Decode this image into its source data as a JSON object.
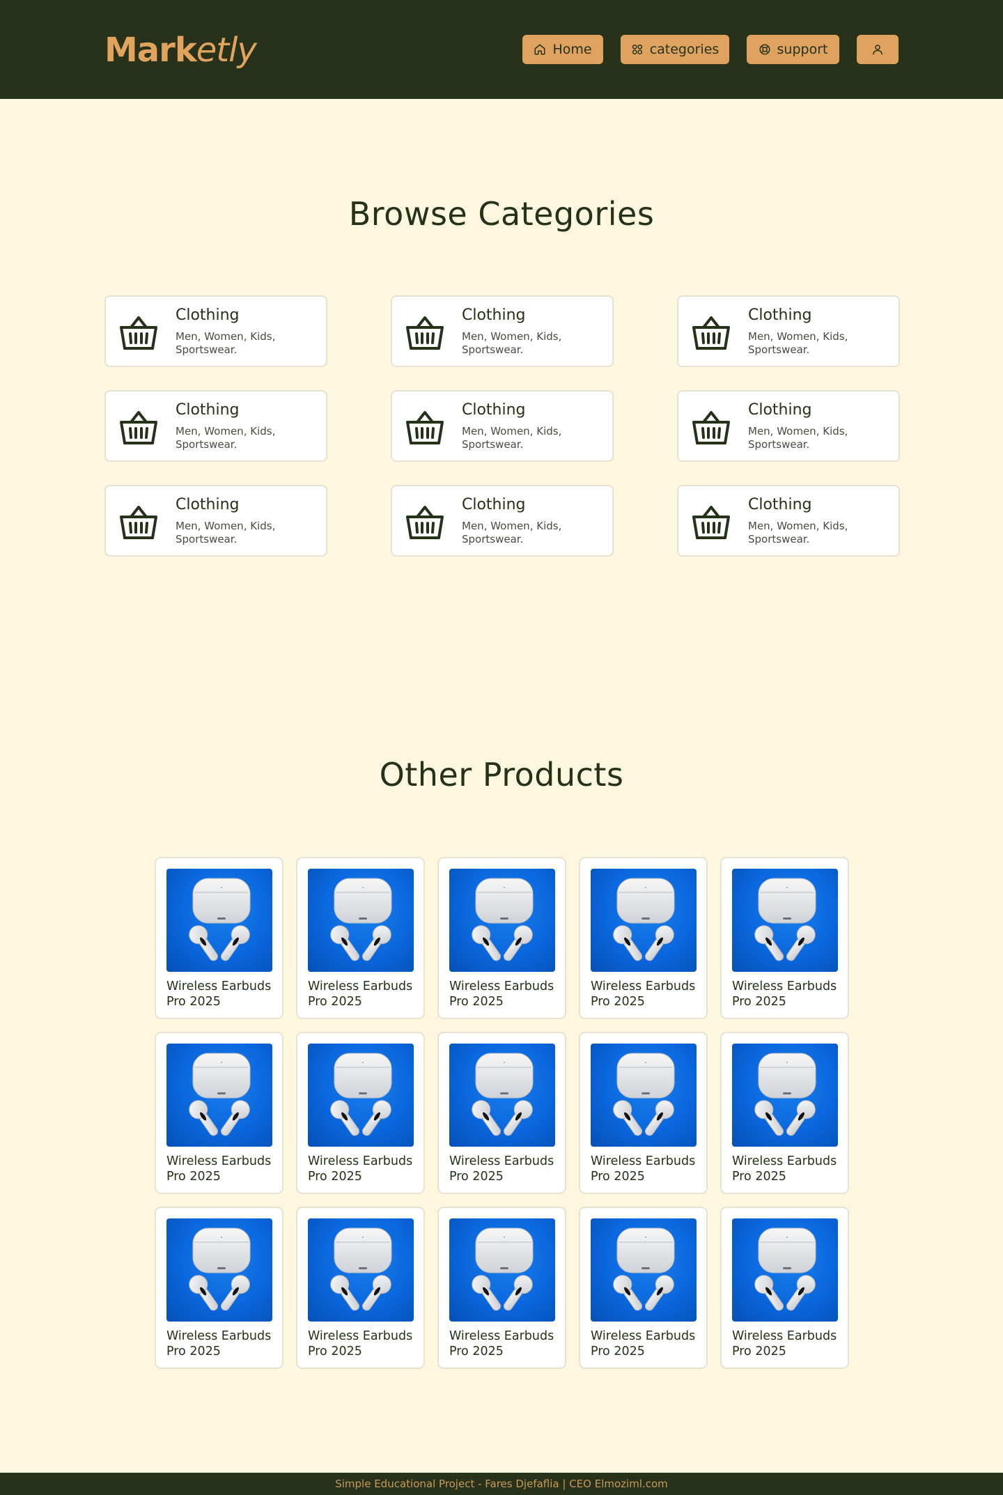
{
  "header": {
    "logo_bold": "Mark",
    "logo_italic": "etly",
    "nav": {
      "home": "Home",
      "categories": "categories",
      "support": "support"
    }
  },
  "categories_section": {
    "title": "Browse Categories",
    "items": [
      {
        "name": "Clothing",
        "desc": "Men, Women, Kids, Sportswear."
      },
      {
        "name": "Clothing",
        "desc": "Men, Women, Kids, Sportswear."
      },
      {
        "name": "Clothing",
        "desc": "Men, Women, Kids, Sportswear."
      },
      {
        "name": "Clothing",
        "desc": "Men, Women, Kids, Sportswear."
      },
      {
        "name": "Clothing",
        "desc": "Men, Women, Kids, Sportswear."
      },
      {
        "name": "Clothing",
        "desc": "Men, Women, Kids, Sportswear."
      },
      {
        "name": "Clothing",
        "desc": "Men, Women, Kids, Sportswear."
      },
      {
        "name": "Clothing",
        "desc": "Men, Women, Kids, Sportswear."
      },
      {
        "name": "Clothing",
        "desc": "Men, Women, Kids, Sportswear."
      }
    ],
    "icon": "basket-icon"
  },
  "products_section": {
    "title": "Other Products",
    "items": [
      {
        "name": "Wireless Earbuds Pro 2025"
      },
      {
        "name": "Wireless Earbuds Pro 2025"
      },
      {
        "name": "Wireless Earbuds Pro 2025"
      },
      {
        "name": "Wireless Earbuds Pro 2025"
      },
      {
        "name": "Wireless Earbuds Pro 2025"
      },
      {
        "name": "Wireless Earbuds Pro 2025"
      },
      {
        "name": "Wireless Earbuds Pro 2025"
      },
      {
        "name": "Wireless Earbuds Pro 2025"
      },
      {
        "name": "Wireless Earbuds Pro 2025"
      },
      {
        "name": "Wireless Earbuds Pro 2025"
      },
      {
        "name": "Wireless Earbuds Pro 2025"
      },
      {
        "name": "Wireless Earbuds Pro 2025"
      },
      {
        "name": "Wireless Earbuds Pro 2025"
      },
      {
        "name": "Wireless Earbuds Pro 2025"
      },
      {
        "name": "Wireless Earbuds Pro 2025"
      }
    ]
  },
  "footer": {
    "text": "Simple Educational Project - Fares Djefaflia | CEO Elmoziml.com"
  },
  "colors": {
    "header_bg": "#28321a",
    "accent": "#dfa35f",
    "page_bg": "#fdf7df",
    "text_dark": "#253219"
  }
}
